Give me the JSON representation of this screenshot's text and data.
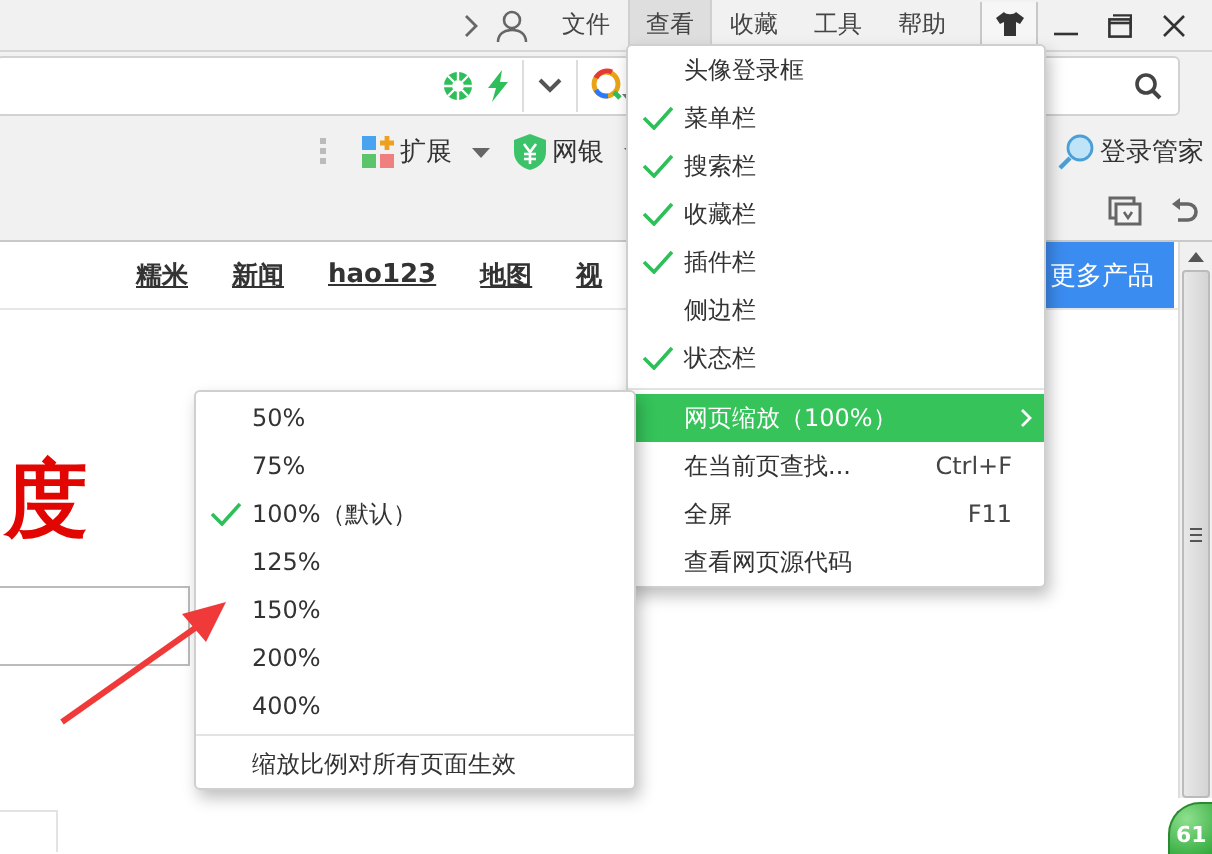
{
  "title_bar": {
    "menus": [
      {
        "label": "文件",
        "selected": false
      },
      {
        "label": "查看",
        "selected": true
      },
      {
        "label": "收藏",
        "selected": false
      },
      {
        "label": "工具",
        "selected": false
      },
      {
        "label": "帮助",
        "selected": false
      }
    ]
  },
  "toolbar": {
    "items": [
      {
        "label": "扩展",
        "kind": "extensions"
      },
      {
        "label": "网银",
        "kind": "bank"
      }
    ],
    "login_manager": "登录管家"
  },
  "page": {
    "nav_links": [
      "糯米",
      "新闻",
      "hao123",
      "地图",
      "视"
    ],
    "more_button": "更多产品",
    "logo_fragment": "度",
    "speed_badge": "61"
  },
  "view_menu": {
    "items": [
      {
        "kind": "toggle",
        "label": "头像登录框",
        "checked": false
      },
      {
        "kind": "toggle",
        "label": "菜单栏",
        "checked": true
      },
      {
        "kind": "toggle",
        "label": "搜索栏",
        "checked": true
      },
      {
        "kind": "toggle",
        "label": "收藏栏",
        "checked": true
      },
      {
        "kind": "toggle",
        "label": "插件栏",
        "checked": true
      },
      {
        "kind": "toggle",
        "label": "侧边栏",
        "checked": false
      },
      {
        "kind": "toggle",
        "label": "状态栏",
        "checked": true
      },
      {
        "kind": "separator"
      },
      {
        "kind": "submenu",
        "label": "网页缩放（100%）",
        "selected": true
      },
      {
        "kind": "command",
        "label": "在当前页查找...",
        "shortcut": "Ctrl+F"
      },
      {
        "kind": "command",
        "label": "全屏",
        "shortcut": "F11"
      },
      {
        "kind": "command",
        "label": "查看网页源代码"
      }
    ]
  },
  "zoom_menu": {
    "items": [
      {
        "label": "50%",
        "checked": false
      },
      {
        "label": "75%",
        "checked": false
      },
      {
        "label": "100%（默认）",
        "checked": true
      },
      {
        "label": "125%",
        "checked": false
      },
      {
        "label": "150%",
        "checked": false
      },
      {
        "label": "200%",
        "checked": false
      },
      {
        "label": "400%",
        "checked": false
      }
    ],
    "footer": "缩放比例对所有页面生效"
  }
}
